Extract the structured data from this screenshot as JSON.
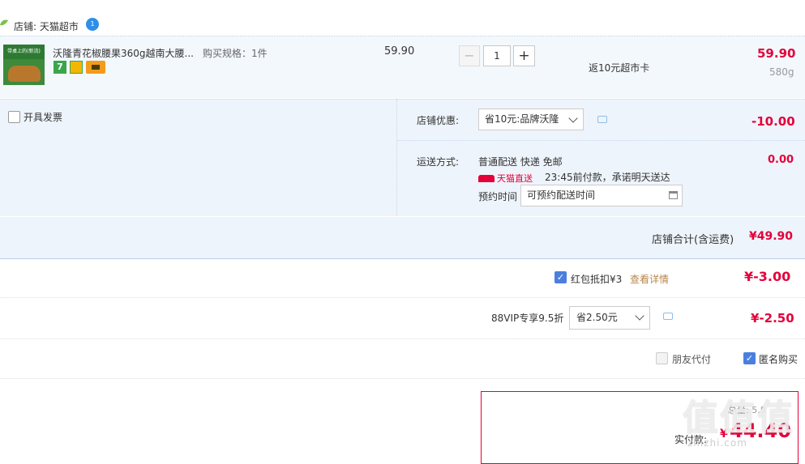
{
  "shop": {
    "label": "店铺: 天猫超市",
    "badge": "1"
  },
  "product": {
    "thumb_caption": "带桌上的(新流)",
    "title": "沃隆青花椒腰果360g越南大腰...",
    "spec": "购买规格：1件",
    "service_badge_1": "7",
    "unit_price": "59.90",
    "qty_minus": "−",
    "quantity": "1",
    "qty_plus": "+",
    "cashback": "返10元超市卡",
    "subtotal": "59.90",
    "weight": "580g"
  },
  "invoice": {
    "label": "开具发票"
  },
  "coupon": {
    "label": "店铺优惠:",
    "selected": "省10元:品牌沃隆",
    "amount": "-10.00"
  },
  "shipping": {
    "label": "运送方式:",
    "method": "普通配送 快递 免邮",
    "tmall_logo": "天猫直送",
    "promise": "23:45前付款，承诺明天送达",
    "appointment_label": "预约时间",
    "appointment_value": "可预约配送时间",
    "fee": "0.00"
  },
  "store_total": {
    "label": "店铺合计(含运费)",
    "value": "¥49.90"
  },
  "red_packet": {
    "checked": true,
    "label": "红包抵扣¥3",
    "detail_link": "查看详情",
    "value": "¥-3.00"
  },
  "vip": {
    "label": "88VIP专享9.5折",
    "selected": "省2.50元",
    "value": "¥-2.50"
  },
  "misc": {
    "friend_pay": "朋友代付",
    "anonymous": "匿名购买",
    "anonymous_checked": true
  },
  "final": {
    "count_label": "总量: 5.8",
    "label": "实付款:",
    "currency": "¥",
    "value": "44.40"
  },
  "watermark": {
    "text": "值值值",
    "url": "zhizhi.com"
  },
  "colors": {
    "price_red": "#e4003a",
    "light_blue_bg": "#eef4fb",
    "check_blue": "#4a7fe0",
    "link_gold": "#b8864b"
  }
}
